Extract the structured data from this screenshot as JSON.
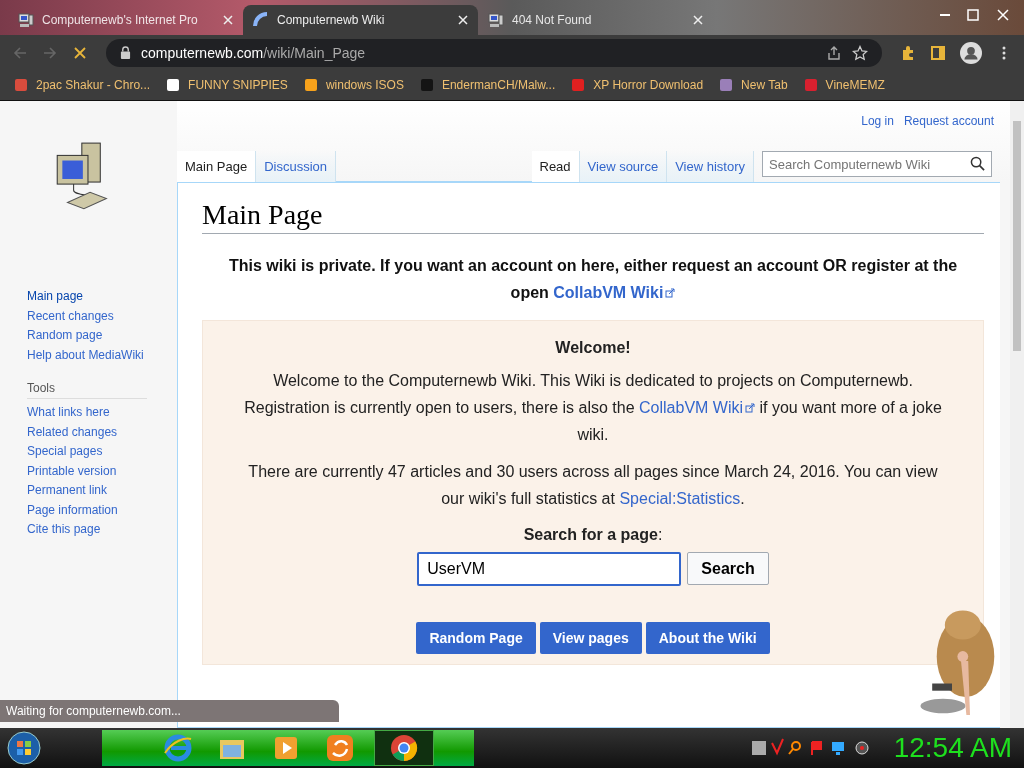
{
  "browser": {
    "tabs": [
      {
        "title": "Computernewb's Internet Pro",
        "selected": false,
        "loading": false
      },
      {
        "title": "Computernewb Wiki",
        "selected": true,
        "loading": true
      },
      {
        "title": "404 Not Found",
        "selected": false,
        "loading": false
      }
    ],
    "address": {
      "domain": "computernewb.com",
      "path": "/wiki/Main_Page"
    },
    "bookmarks": [
      {
        "label": "2pac Shakur - Chro...",
        "color": "#d94c3d"
      },
      {
        "label": "FUNNY SNIPPIES",
        "color": "#ffffff"
      },
      {
        "label": "windows ISOS",
        "color": "#f7a21b"
      },
      {
        "label": "EndermanCH/Malw...",
        "color": "#141414"
      },
      {
        "label": "XP Horror Download",
        "color": "#e02020"
      },
      {
        "label": "New Tab",
        "color": "#9a7fb8"
      },
      {
        "label": "VineMEMZ",
        "color": "#d8202f"
      }
    ]
  },
  "wiki": {
    "personal_links": [
      "Log in",
      "Request account"
    ],
    "navigation": [
      "Main page",
      "Recent changes",
      "Random page",
      "Help about MediaWiki"
    ],
    "tools_heading": "Tools",
    "tools": [
      "What links here",
      "Related changes",
      "Special pages",
      "Printable version",
      "Permanent link",
      "Page information",
      "Cite this page"
    ],
    "page_tabs": [
      {
        "label": "Main Page",
        "selected": true
      },
      {
        "label": "Discussion",
        "selected": false
      }
    ],
    "view_tabs": [
      {
        "label": "Read",
        "selected": true
      },
      {
        "label": "View source",
        "selected": false
      },
      {
        "label": "View history",
        "selected": false
      }
    ],
    "search_placeholder": "Search Computernewb Wiki",
    "title": "Main Page",
    "notice": {
      "text": "This wiki is private. If you want an account on here, either request an account OR register at the open ",
      "link": "CollabVM Wiki"
    },
    "welcome": {
      "heading": "Welcome!",
      "paragraphs": [
        [
          {
            "text": "Welcome to the Computernewb Wiki. This Wiki is dedicated to projects on Computernewb. Registration is currently open to users, there is also the "
          },
          {
            "link": "CollabVM Wiki",
            "external": true
          },
          {
            "text": " if you want more of a joke wiki."
          }
        ],
        [
          {
            "text": "There are currently 47 articles and 30 users across all pages since March 24, 2016. You can view our wiki's full statistics at "
          },
          {
            "link": "Special:Statistics",
            "external": false
          },
          {
            "text": "."
          }
        ]
      ],
      "search_label": "**Search for a page**:",
      "search_value": "UserVM",
      "search_button": "Search",
      "buttons": [
        "Random Page",
        "View pages",
        "About the Wiki"
      ]
    }
  },
  "status_text": "Waiting for computernewb.com...",
  "taskbar": {
    "apps": [
      {
        "kind": "ie",
        "selected": false
      },
      {
        "kind": "folder",
        "selected": false
      },
      {
        "kind": "media",
        "selected": false
      },
      {
        "kind": "uc",
        "selected": false
      },
      {
        "kind": "chrome",
        "selected": true
      }
    ],
    "clock": "12:54 AM"
  }
}
